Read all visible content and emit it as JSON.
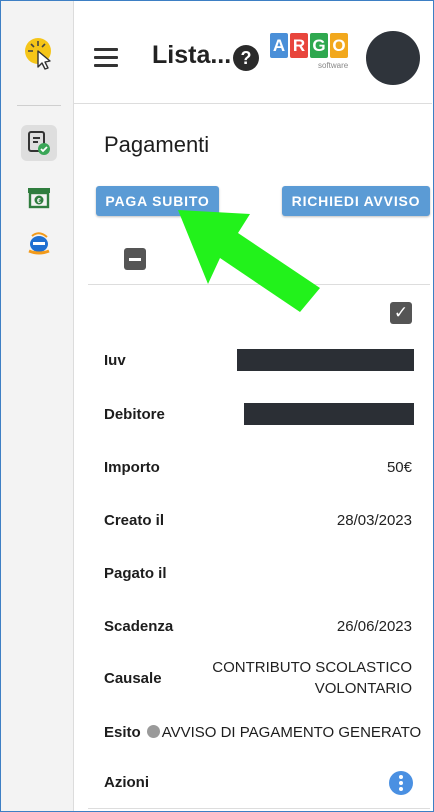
{
  "app": {
    "title": "Lista...",
    "help_symbol": "?",
    "brand_letters": [
      "A",
      "R",
      "G",
      "O"
    ],
    "brand_colors": [
      "#4a8fd8",
      "#e8453c",
      "#2fa84f",
      "#f2a81d"
    ],
    "brand_sub": "software"
  },
  "page": {
    "title": "Pagamenti",
    "pay_now_label": "PAGA SUBITO",
    "request_notice_label": "RICHIEDI AVVISO"
  },
  "rail": {
    "items": [
      "receipt-check-icon",
      "cash-register-icon",
      "ie-browser-icon"
    ]
  },
  "details": {
    "iuv_label": "Iuv",
    "debitore_label": "Debitore",
    "importo_label": "Importo",
    "importo_value": "50€",
    "creato_label": "Creato il",
    "creato_value": "28/03/2023",
    "pagato_label": "Pagato il",
    "pagato_value": "",
    "scadenza_label": "Scadenza",
    "scadenza_value": "26/06/2023",
    "causale_label": "Causale",
    "causale_line1": "CONTRIBUTO SCOLASTICO",
    "causale_line2": "VOLONTARIO",
    "esito_label": "Esito",
    "esito_value": "AVVISO DI PAGAMENTO GENERATO",
    "azioni_label": "Azioni"
  },
  "colors": {
    "accent": "#5b9bd5",
    "annotation_arrow": "#22f21b"
  }
}
